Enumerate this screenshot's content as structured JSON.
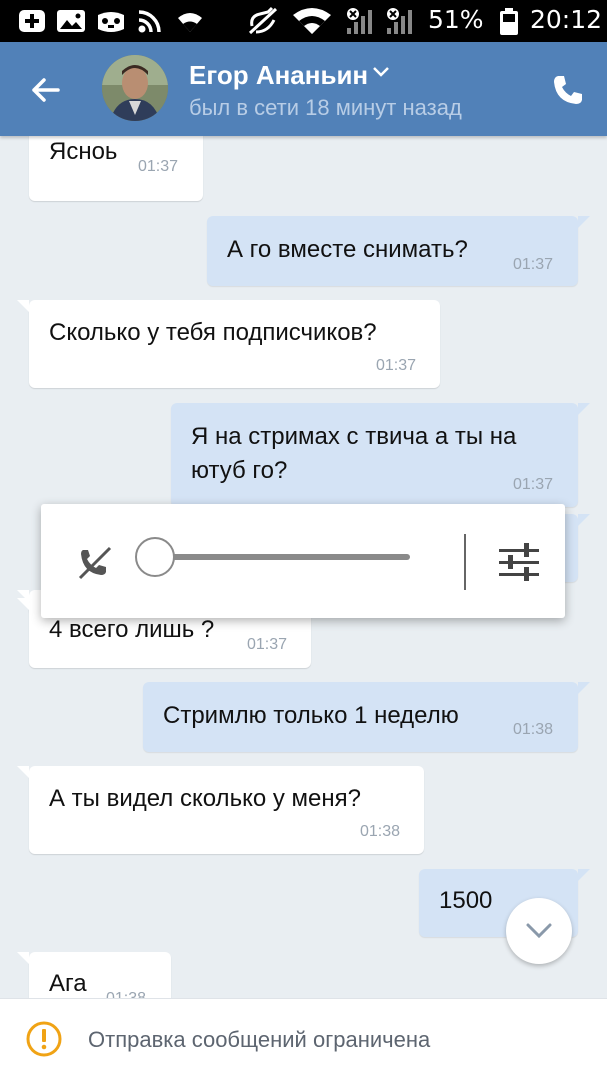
{
  "statusbar": {
    "battery": "51%",
    "time": "20:12",
    "icons": [
      "plus-icon",
      "image-icon",
      "game-icon",
      "rss-icon",
      "wifi-icon",
      "mute-icon",
      "wifi-signal-icon",
      "cell-signal-icon",
      "cell-signal-icon",
      "battery-icon"
    ]
  },
  "header": {
    "contact_name": "Егор Ананьин",
    "contact_status": "был в сети 18 минут назад",
    "accent_color": "#5181b8"
  },
  "messages": [
    {
      "direction": "in",
      "text": "Ясноь",
      "time": "01:37"
    },
    {
      "direction": "out",
      "text": "А го вместе снимать?",
      "time": "01:37"
    },
    {
      "direction": "in",
      "text": "Сколько у тебя подписчиков?",
      "time": "01:37"
    },
    {
      "direction": "out",
      "lines": [
        "Я на стримах с твича а ты на",
        "ютуб го?"
      ],
      "time": "01:37"
    },
    {
      "direction": "in",
      "text": "4 всего лишь ?",
      "time": "01:37"
    },
    {
      "direction": "out",
      "text": "Стримлю только 1 неделю",
      "time": "01:38"
    },
    {
      "direction": "in",
      "text": "А ты видел сколько у меня?",
      "time": "01:38"
    },
    {
      "direction": "out",
      "text": "1500"
    },
    {
      "direction": "in",
      "text": "Ага",
      "time": "01:38"
    }
  ],
  "volume_popup": {
    "level": 0
  },
  "footer": {
    "notice": "Отправка сообщений ограничена"
  }
}
